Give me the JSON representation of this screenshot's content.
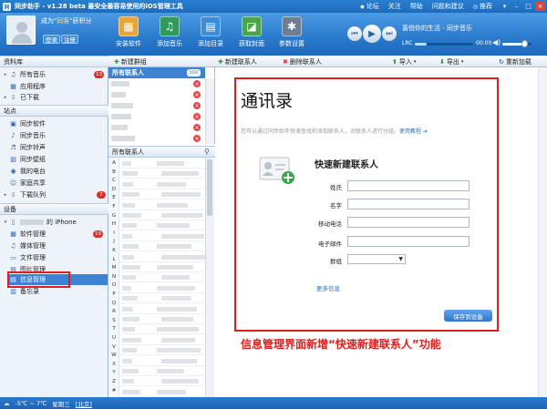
{
  "titlebar": {
    "title": "同步助手 - v1.28 beta  最安全最容易使用的iOS管理工具",
    "links": [
      {
        "icon": "forum-icon",
        "glyph": "◆",
        "label": "论坛"
      },
      {
        "icon": "follow-icon",
        "glyph": "",
        "label": "关注"
      },
      {
        "icon": "help-icon",
        "glyph": "",
        "label": "帮助"
      },
      {
        "icon": "feedback-icon",
        "glyph": "",
        "label": "问题和建议"
      },
      {
        "icon": "recommend-icon",
        "glyph": "◎",
        "label": "推荐"
      }
    ]
  },
  "user": {
    "name_line_prefix": "成为\"",
    "name_line_highlight": "同客",
    "name_line_suffix": "\"获积分",
    "login": "登录",
    "register": "注册"
  },
  "tools": [
    {
      "icon": "install-software-icon",
      "glyph": "▦",
      "label": "安装软件",
      "color": "#e7a537"
    },
    {
      "icon": "add-music-icon",
      "glyph": "♫",
      "label": "添加音乐",
      "color": "#2f9a5b"
    },
    {
      "icon": "add-folder-icon",
      "glyph": "▤",
      "label": "添加目录",
      "color": "#3b8ddb"
    },
    {
      "icon": "get-cover-icon",
      "glyph": "◪",
      "label": "获取封面",
      "color": "#4aa64a"
    },
    {
      "icon": "settings-icon",
      "glyph": "✱",
      "label": "参数设置",
      "color": "#6d7f93"
    }
  ],
  "player": {
    "song": "喜悦你的生活 - 同步音乐",
    "lrc": "LRC",
    "time": "00:00",
    "progress": 0.2,
    "volume": 0.75
  },
  "sidebar": {
    "library_header": "资料库",
    "library_items": [
      {
        "icon": "music-note-icon",
        "glyph": "♫",
        "label": "所有音乐",
        "badge": "13",
        "expander": "▸"
      },
      {
        "icon": "app-grid-icon",
        "glyph": "▦",
        "label": "应用程序",
        "badge": "",
        "expander": ""
      },
      {
        "icon": "download-icon",
        "glyph": "⇩",
        "label": "已下载",
        "badge": "",
        "expander": "▸"
      }
    ],
    "site_header": "站点",
    "site_items": [
      {
        "icon": "sync-software-icon",
        "glyph": "▣",
        "label": "同步软件"
      },
      {
        "icon": "sync-music-icon",
        "glyph": "♪",
        "label": "同步音乐"
      },
      {
        "icon": "sync-ringtone-icon",
        "glyph": "♬",
        "label": "同步铃声"
      },
      {
        "icon": "sync-wallpaper-icon",
        "glyph": "▨",
        "label": "同步壁纸"
      },
      {
        "icon": "radio-icon",
        "glyph": "◉",
        "label": "我的电台"
      },
      {
        "icon": "family-share-icon",
        "glyph": "☺",
        "label": "家庭共享"
      },
      {
        "icon": "download-queue-icon",
        "glyph": "⇩",
        "label": "下载队列",
        "badge": "7"
      }
    ],
    "device_header": "设备",
    "device_name_suffix": "的 iPhone",
    "device_items": [
      {
        "icon": "software-manage-icon",
        "glyph": "▦",
        "label": "软件管理",
        "badge": "10"
      },
      {
        "icon": "media-manage-icon",
        "glyph": "♫",
        "label": "媒体管理",
        "badge": ""
      },
      {
        "icon": "file-manage-icon",
        "glyph": "▭",
        "label": "文件管理",
        "badge": ""
      },
      {
        "icon": "image-manage-icon",
        "glyph": "▨",
        "label": "图片管理",
        "badge": ""
      },
      {
        "icon": "info-manage-icon",
        "glyph": "▤",
        "label": "信息管理",
        "badge": "",
        "selected": true
      },
      {
        "icon": "memo-icon",
        "glyph": "▥",
        "label": "备忘录",
        "badge": ""
      }
    ]
  },
  "toolbar": {
    "new_group": "新建群组",
    "new_contact": "新建联系人",
    "delete_contact": "删除联系人",
    "import": "导入",
    "export": "导出",
    "reload": "重新加载"
  },
  "groups": {
    "header": "所有联系人",
    "count": "300",
    "rows": 6
  },
  "contacts": {
    "header": "所有联系人",
    "alphabet": [
      "A",
      "B",
      "C",
      "D",
      "E",
      "F",
      "G",
      "H",
      "I",
      "J",
      "K",
      "L",
      "M",
      "N",
      "O",
      "P",
      "Q",
      "R",
      "S",
      "T",
      "U",
      "V",
      "W",
      "X",
      "Y",
      "Z",
      "#"
    ]
  },
  "main": {
    "title": "通讯录",
    "intro": "您可以通过同步助手快速查找和添加联系人，对联系人进行分组。",
    "intro_link": "使用教程 ➜",
    "quick_add_title": "快速新建联系人",
    "fields": [
      "姓氏",
      "名字",
      "移动电话",
      "电子邮件"
    ],
    "group_label": "群组",
    "group_value": "",
    "more_info": "更多信息",
    "save": "保存到设备"
  },
  "caption": "信息管理界面新增“快速新建联系人”功能",
  "status": {
    "weather": "-5℃ ~ 7℃",
    "weekday": "星期三",
    "city": "[北京]"
  }
}
